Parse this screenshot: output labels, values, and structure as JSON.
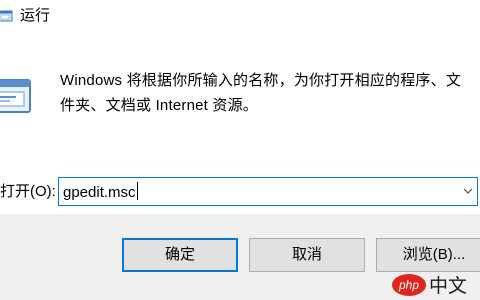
{
  "window": {
    "title": "运行"
  },
  "description": "Windows 将根据你所输入的名称，为你打开相应的程序、文件夹、文档或 Internet 资源。",
  "open_field": {
    "label": "打开(O):",
    "value": "gpedit.msc"
  },
  "buttons": {
    "ok": "确定",
    "cancel": "取消",
    "browse": "浏览(B)..."
  },
  "watermark": {
    "text": "php 中文网"
  },
  "colors": {
    "accent": "#0078d7",
    "footer_bg": "#f0f0f0",
    "button_bg": "#e1e1e1",
    "watermark_red": "#e1251b"
  },
  "icons": [
    "run-app-icon",
    "run-dialog-icon",
    "chevron-down-icon"
  ]
}
